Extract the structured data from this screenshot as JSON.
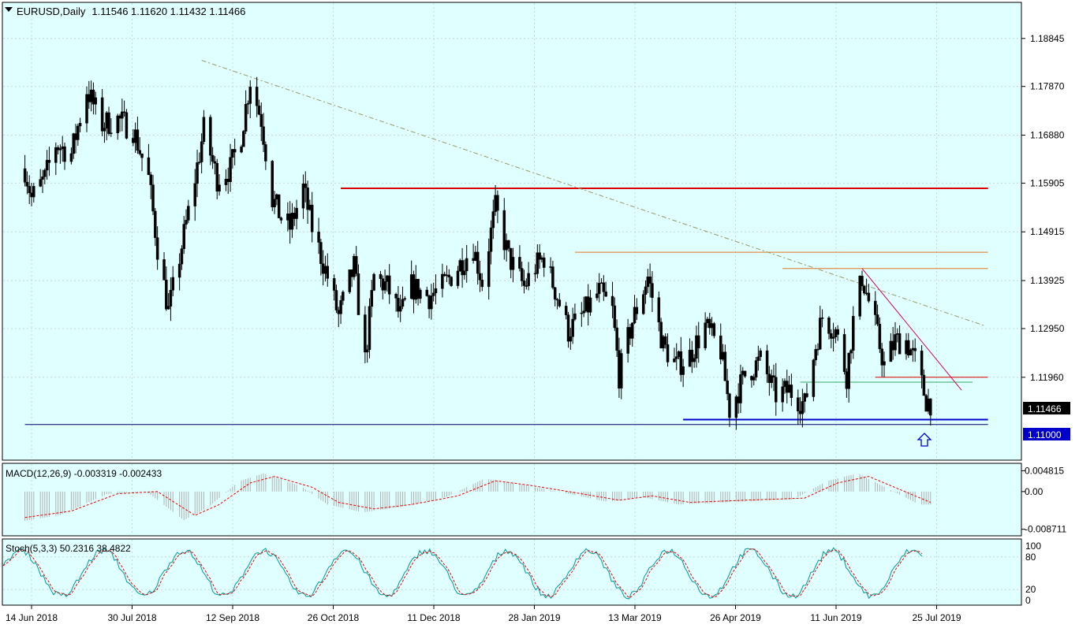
{
  "header": {
    "symbol": "EURUSD,Daily",
    "ohlc": "1.11546 1.11620 1.11432 1.11466"
  },
  "colors": {
    "background": "#e0ffff",
    "candle": "#000000",
    "resistance_red": "#dd0000",
    "resistance_orange": "#e07820",
    "support_blue": "#0000cc",
    "downtrend_line": "#cc0066",
    "green_line": "#33aa66",
    "long_trend_dashed": "#999966",
    "price_tag": "#000000",
    "support_tag": "#0000cc",
    "macd_signal": "#ee0000",
    "macd_hist": "#b0b0b0",
    "stoch_main": "#009999",
    "stoch_signal": "#ee0000"
  },
  "icons": {
    "collapse": "triangle-down-icon",
    "up_arrow": "up-arrow-icon"
  },
  "chart_data": [
    {
      "type": "candlestick",
      "title": "EURUSD,Daily",
      "ohlc_last": {
        "open": 1.11546,
        "high": 1.1162,
        "low": 1.11432,
        "close": 1.11466
      },
      "ylim": [
        1.107,
        1.1925
      ],
      "y_ticks": [
        "1.18845",
        "1.17870",
        "1.16880",
        "1.15905",
        "1.14915",
        "1.13925",
        "1.12950",
        "1.11960"
      ],
      "x_ticks": [
        "14 Jun 2018",
        "30 Jul 2018",
        "12 Sep 2018",
        "26 Oct 2018",
        "11 Dec 2018",
        "28 Jan 2019",
        "13 Mar 2019",
        "26 Apr 2019",
        "11 Jun 2019",
        "25 Jul 2019"
      ],
      "current_price_label": "1.11466",
      "support_label": "1.11000",
      "close_path": [
        [
          "2018-06-11",
          1.162
        ],
        [
          "2018-06-14",
          1.156
        ],
        [
          "2018-06-20",
          1.16
        ],
        [
          "2018-06-25",
          1.167
        ],
        [
          "2018-07-02",
          1.165
        ],
        [
          "2018-07-09",
          1.178
        ],
        [
          "2018-07-16",
          1.171
        ],
        [
          "2018-07-23",
          1.172
        ],
        [
          "2018-07-30",
          1.17
        ],
        [
          "2018-08-06",
          1.16
        ],
        [
          "2018-08-10",
          1.146
        ],
        [
          "2018-08-15",
          1.133
        ],
        [
          "2018-08-20",
          1.144
        ],
        [
          "2018-08-27",
          1.16
        ],
        [
          "2018-08-31",
          1.17
        ],
        [
          "2018-09-06",
          1.16
        ],
        [
          "2018-09-12",
          1.162
        ],
        [
          "2018-09-17",
          1.169
        ],
        [
          "2018-09-21",
          1.18
        ],
        [
          "2018-09-26",
          1.172
        ],
        [
          "2018-10-01",
          1.156
        ],
        [
          "2018-10-05",
          1.152
        ],
        [
          "2018-10-09",
          1.15
        ],
        [
          "2018-10-15",
          1.158
        ],
        [
          "2018-10-19",
          1.15
        ],
        [
          "2018-10-26",
          1.14
        ],
        [
          "2018-10-31",
          1.132
        ],
        [
          "2018-11-07",
          1.142
        ],
        [
          "2018-11-12",
          1.123
        ],
        [
          "2018-11-16",
          1.14
        ],
        [
          "2018-11-22",
          1.138
        ],
        [
          "2018-11-28",
          1.132
        ],
        [
          "2018-12-03",
          1.138
        ],
        [
          "2018-12-11",
          1.136
        ],
        [
          "2018-12-17",
          1.138
        ],
        [
          "2018-12-24",
          1.142
        ],
        [
          "2018-12-31",
          1.146
        ],
        [
          "2019-01-04",
          1.139
        ],
        [
          "2019-01-10",
          1.154
        ],
        [
          "2019-01-16",
          1.144
        ],
        [
          "2019-01-23",
          1.138
        ],
        [
          "2019-01-28",
          1.142
        ],
        [
          "2019-02-01",
          1.144
        ],
        [
          "2019-02-07",
          1.136
        ],
        [
          "2019-02-12",
          1.129
        ],
        [
          "2019-02-18",
          1.132
        ],
        [
          "2019-02-26",
          1.137
        ],
        [
          "2019-03-04",
          1.133
        ],
        [
          "2019-03-07",
          1.12
        ],
        [
          "2019-03-13",
          1.131
        ],
        [
          "2019-03-20",
          1.14
        ],
        [
          "2019-03-27",
          1.126
        ],
        [
          "2019-04-02",
          1.122
        ],
        [
          "2019-04-08",
          1.124
        ],
        [
          "2019-04-15",
          1.13
        ],
        [
          "2019-04-22",
          1.125
        ],
        [
          "2019-04-26",
          1.113
        ],
        [
          "2019-05-03",
          1.12
        ],
        [
          "2019-05-10",
          1.123
        ],
        [
          "2019-05-17",
          1.116
        ],
        [
          "2019-05-23",
          1.117
        ],
        [
          "2019-05-30",
          1.114
        ],
        [
          "2019-06-04",
          1.126
        ],
        [
          "2019-06-07",
          1.132
        ],
        [
          "2019-06-13",
          1.129
        ],
        [
          "2019-06-18",
          1.12
        ],
        [
          "2019-06-21",
          1.131
        ],
        [
          "2019-06-25",
          1.14
        ],
        [
          "2019-07-01",
          1.13
        ],
        [
          "2019-07-05",
          1.122
        ],
        [
          "2019-07-10",
          1.127
        ],
        [
          "2019-07-15",
          1.127
        ],
        [
          "2019-07-19",
          1.123
        ],
        [
          "2019-07-24",
          1.115
        ],
        [
          "2019-07-26",
          1.1146
        ]
      ],
      "annotations": [
        {
          "type": "horizontal",
          "name": "resistance-red",
          "price": 1.158,
          "from": "2018-11-01",
          "to": "2019-08-21"
        },
        {
          "type": "horizontal",
          "name": "resistance-orange-1",
          "price": 1.145,
          "from": "2019-02-15",
          "to": "2019-08-21"
        },
        {
          "type": "horizontal",
          "name": "resistance-orange-2",
          "price": 1.1417,
          "from": "2019-05-20",
          "to": "2019-08-21"
        },
        {
          "type": "horizontal",
          "name": "red-short",
          "price": 1.1196,
          "from": "2019-07-01",
          "to": "2019-08-21"
        },
        {
          "type": "horizontal",
          "name": "green-short",
          "price": 1.1186,
          "from": "2019-05-28",
          "to": "2019-08-14"
        },
        {
          "type": "horizontal",
          "name": "support-blue",
          "price": 1.111,
          "from": "2019-04-05",
          "to": "2019-08-21"
        },
        {
          "type": "horizontal",
          "name": "support-dark",
          "price": 1.11,
          "from": "2018-06-11",
          "to": "2019-08-21"
        },
        {
          "type": "trendline",
          "name": "long-downtrend",
          "x1": "2018-08-30",
          "y1": 1.184,
          "x2": "2019-08-20",
          "y2": 1.13
        },
        {
          "type": "trendline",
          "name": "short-downtrend",
          "x1": "2019-06-25",
          "y1": 1.1417,
          "x2": "2019-08-09",
          "y2": 1.117
        }
      ]
    },
    {
      "type": "macd",
      "title": "MACD(12,26,9) -0.003319 -0.002433",
      "params": "12,26,9",
      "values": {
        "macd": -0.003319,
        "signal": -0.002433
      },
      "ylim": [
        -0.0095,
        0.0058
      ],
      "y_ticks": [
        "0.004815",
        "0.00",
        "-0.008711"
      ],
      "signal_path": [
        [
          "2018-06-11",
          -0.006
        ],
        [
          "2018-07-02",
          -0.0045
        ],
        [
          "2018-07-23",
          -0.0005
        ],
        [
          "2018-08-10",
          0.0
        ],
        [
          "2018-08-27",
          -0.0055
        ],
        [
          "2018-09-07",
          -0.003
        ],
        [
          "2018-09-21",
          0.002
        ],
        [
          "2018-10-02",
          0.0035
        ],
        [
          "2018-10-19",
          0.001
        ],
        [
          "2018-10-31",
          -0.0025
        ],
        [
          "2018-11-16",
          -0.004
        ],
        [
          "2018-12-03",
          -0.003
        ],
        [
          "2018-12-24",
          -0.001
        ],
        [
          "2019-01-10",
          0.0025
        ],
        [
          "2019-01-25",
          0.0015
        ],
        [
          "2019-02-18",
          -0.0005
        ],
        [
          "2019-03-07",
          -0.002
        ],
        [
          "2019-03-22",
          -0.001
        ],
        [
          "2019-04-08",
          -0.0025
        ],
        [
          "2019-05-03",
          -0.002
        ],
        [
          "2019-05-30",
          -0.0015
        ],
        [
          "2019-06-14",
          0.002
        ],
        [
          "2019-06-28",
          0.0035
        ],
        [
          "2019-07-12",
          0.0005
        ],
        [
          "2019-07-26",
          -0.0025
        ]
      ]
    },
    {
      "type": "stochastic",
      "title": "Stoch(5,3,3) 50.2316 38.4822",
      "params": "5,3,3",
      "values": {
        "main": 50.2316,
        "signal": 38.4822
      },
      "ylim": [
        0,
        100
      ],
      "y_ticks": [
        "100",
        "80",
        "20",
        "0"
      ]
    }
  ]
}
